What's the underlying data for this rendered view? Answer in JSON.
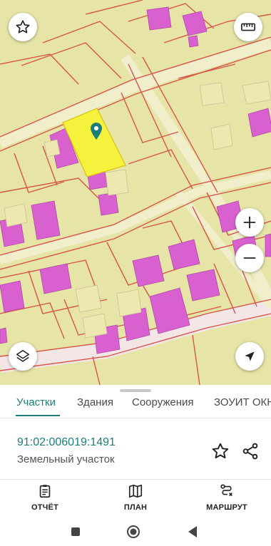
{
  "colors": {
    "map_background": "#e6e4a6",
    "parcel_outline": "#d9544a",
    "building": "#d861cf",
    "selected_parcel": "#f5f23d",
    "accent": "#1a7f7a"
  },
  "map": {
    "favorite_icon": "star-outline-icon",
    "ruler_icon": "ruler-icon",
    "zoom_in_icon": "plus-icon",
    "zoom_out_icon": "minus-icon",
    "layers_icon": "layers-icon",
    "location_icon": "navigation-arrow-icon",
    "marker_icon": "map-pin-icon"
  },
  "tabs": {
    "items": [
      "Участки",
      "Здания",
      "Сооружения",
      "ЗОУИТ ОКН"
    ],
    "active": 0
  },
  "parcel": {
    "cadastral_number": "91:02:006019:1491",
    "type": "Земельный участок"
  },
  "bottom_nav": {
    "report": "ОТЧЁТ",
    "plan": "ПЛАН",
    "route": "МАРШРУТ"
  }
}
